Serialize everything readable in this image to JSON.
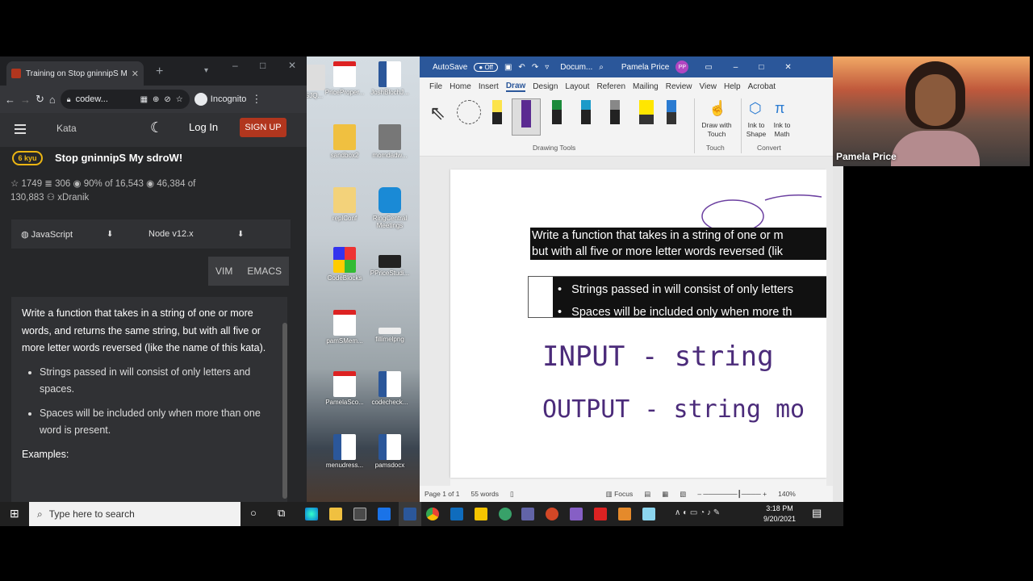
{
  "chrome": {
    "tab_title": "Training on Stop gninnipS My s",
    "address": "codew...",
    "incognito_label": "Incognito"
  },
  "codewars": {
    "nav_kata": "Kata",
    "login": "Log In",
    "signup": "SIGN UP",
    "kyu": "6 kyu",
    "title": "Stop gninnipS My sdroW!",
    "stats_line1": "☆ 1749  ≣ 306   ◉ 90% of 16,543   ◉ 46,384 of",
    "stats_line2": "130,883   ⚇ xDranik",
    "language": "JavaScript",
    "version": "Node v12.x",
    "vim": "VIM",
    "emacs": "EMACS",
    "description": "Write a function that takes in a string of one or more words, and returns the same string, but with all five or more letter words reversed (like the name of this kata).",
    "bullets": [
      "Strings passed in will consist of only letters and spaces.",
      "Spaces will be included only when more than one word is present."
    ],
    "examples_label": "Examples:"
  },
  "desktop_icons": [
    {
      "label": "SJQ..."
    },
    {
      "label": "PriceProper..."
    },
    {
      "label": "JoshBlochJ..."
    },
    {
      "label": "sandbox2"
    },
    {
      "label": "momdadw..."
    },
    {
      "label": "replConf"
    },
    {
      "label": "RingCentral Meetings"
    },
    {
      "label": "CodeBlocks"
    },
    {
      "label": "PPriceStudi..."
    },
    {
      "label": "pamSMem..."
    },
    {
      "label": "fillimelpng"
    },
    {
      "label": "PamelaSco..."
    },
    {
      "label": "codecheck..."
    },
    {
      "label": "menudress..."
    },
    {
      "label": "pamsdocx"
    }
  ],
  "word": {
    "autosave": "AutoSave",
    "toggle": "Off",
    "doc": "Docum...",
    "user": "Pamela Price",
    "user_initials": "PP",
    "tabs": [
      "File",
      "Home",
      "Insert",
      "Draw",
      "Design",
      "Layout",
      "Referen",
      "Mailing",
      "Review",
      "View",
      "Help",
      "Acrobat"
    ],
    "drawing_tools": "Drawing Tools",
    "draw_with_touch": "Draw with Touch",
    "touch": "Touch",
    "ink_to_shape": "Ink to Shape",
    "ink_to_math": "Ink to Math",
    "convert": "Convert",
    "paragraph_line1": "Write a function that takes in a string of one or m",
    "paragraph_line2": "but with all five or more letter words reversed (lik",
    "bullet1": "Strings passed in will consist of only letters",
    "bullet2": "Spaces will be included only when more th",
    "ink_input": "INPUT  -  string",
    "ink_output": "OUTPUT  -  string mo",
    "status_page": "Page 1 of 1",
    "status_words": "55 words",
    "focus": "Focus",
    "zoom": "140%"
  },
  "webcam": {
    "name": "Pamela Price"
  },
  "taskbar": {
    "search_placeholder": "Type here to search",
    "time": "3:18 PM",
    "date": "9/20/2021"
  }
}
